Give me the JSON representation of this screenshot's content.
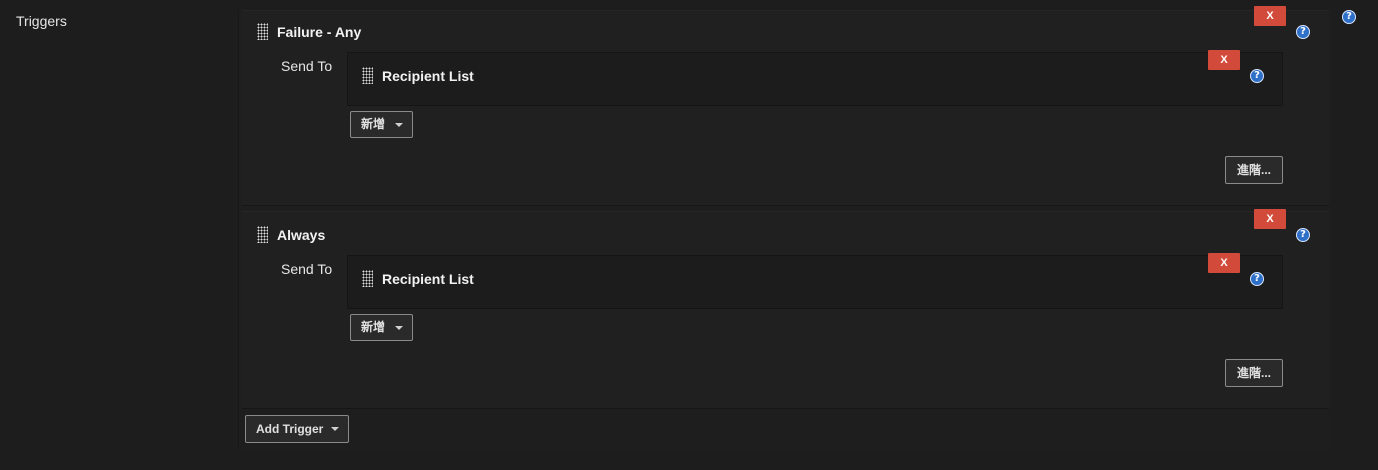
{
  "section": {
    "label": "Triggers"
  },
  "help_glyph": "?",
  "remove_glyph": "X",
  "triggers": [
    {
      "title": "Failure - Any",
      "send_to_label": "Send To",
      "recipient": "Recipient List",
      "add_label": "新增",
      "advanced_label": "進階..."
    },
    {
      "title": "Always",
      "send_to_label": "Send To",
      "recipient": "Recipient List",
      "add_label": "新增",
      "advanced_label": "進階..."
    }
  ],
  "add_trigger_label": "Add Trigger",
  "colors": {
    "background": "#1d1d1d",
    "remove_button": "#d24a3a",
    "help_icon": "#2e6fc8"
  }
}
